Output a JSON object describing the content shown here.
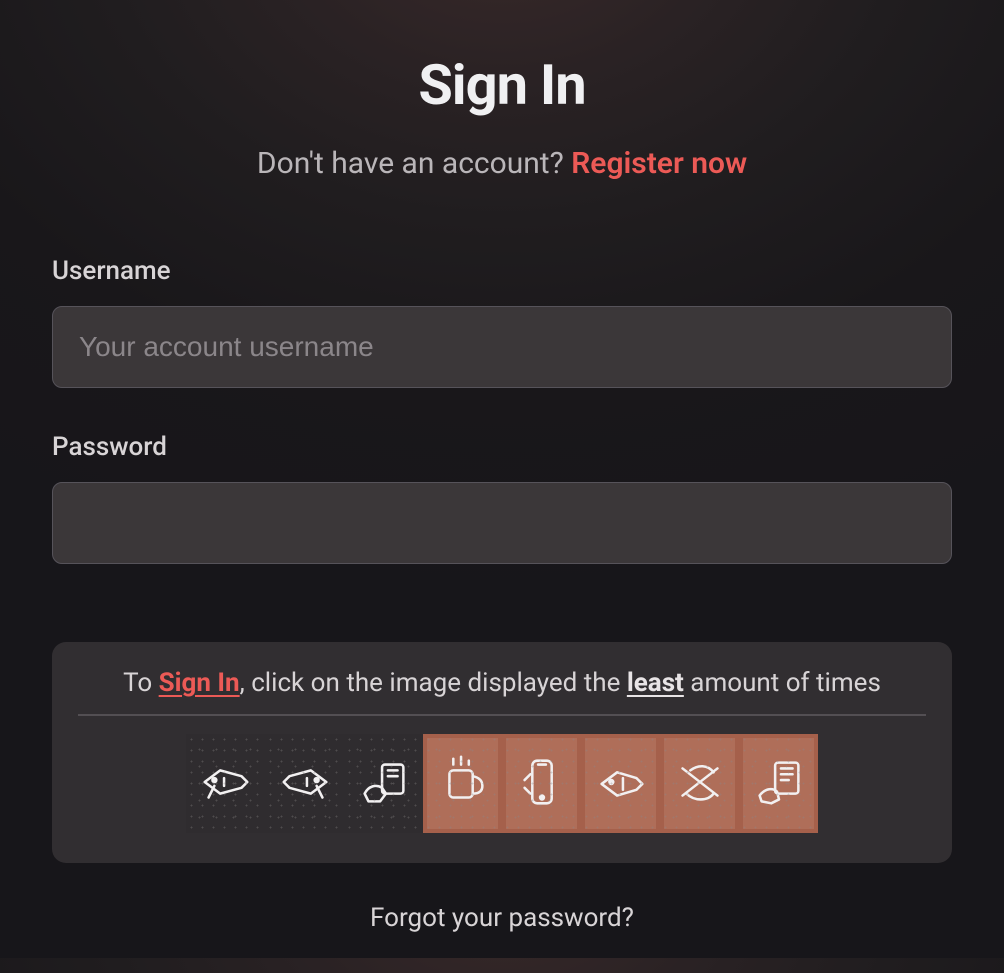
{
  "heading": "Sign In",
  "subtitle_prefix": "Don't have an account? ",
  "register_link": "Register now",
  "form": {
    "username_label": "Username",
    "username_placeholder": "Your account username",
    "username_value": "",
    "password_label": "Password",
    "password_value": ""
  },
  "captcha": {
    "prefix": "To ",
    "signin_word": "Sign In",
    "mid": ", click on the image displayed the ",
    "least_word": "least",
    "suffix": " amount of times",
    "tiles": [
      {
        "highlighted": false
      },
      {
        "highlighted": false
      },
      {
        "highlighted": false
      },
      {
        "highlighted": true
      },
      {
        "highlighted": true
      },
      {
        "highlighted": true
      },
      {
        "highlighted": true
      },
      {
        "highlighted": true
      }
    ]
  },
  "forgot_password": "Forgot your password?"
}
